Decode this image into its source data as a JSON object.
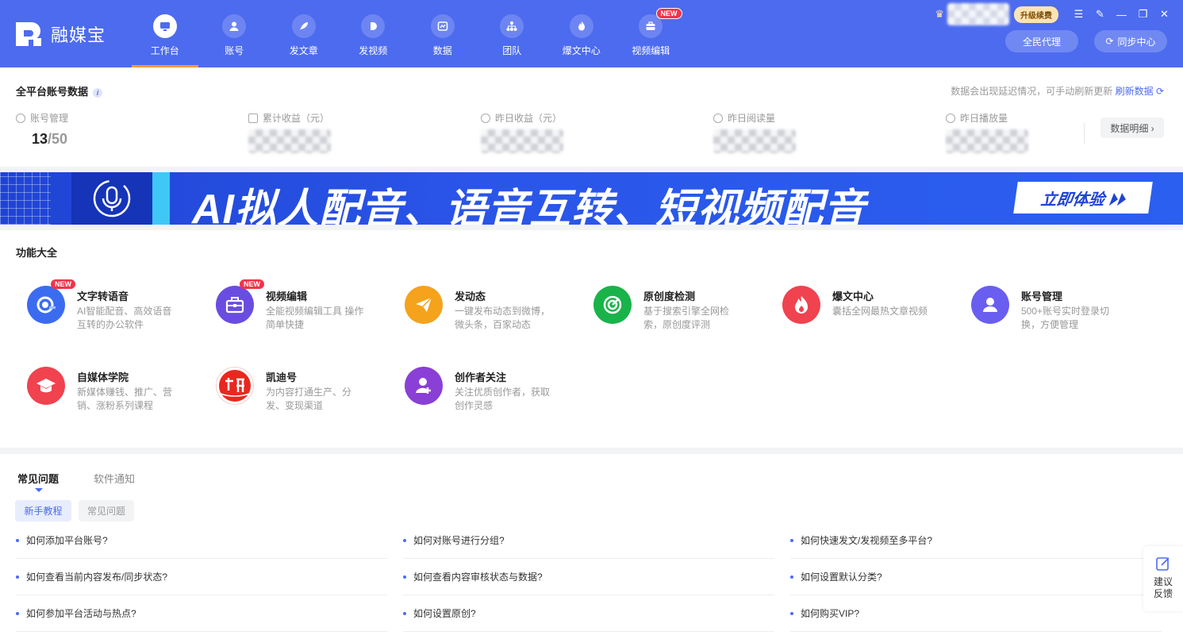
{
  "app": {
    "name": "融媒宝"
  },
  "nav": [
    {
      "label": "工作台",
      "icon": "monitor-icon",
      "active": true
    },
    {
      "label": "账号",
      "icon": "user-icon"
    },
    {
      "label": "发文章",
      "icon": "feather-icon"
    },
    {
      "label": "发视频",
      "icon": "play-icon"
    },
    {
      "label": "数据",
      "icon": "chart-icon"
    },
    {
      "label": "团队",
      "icon": "team-icon"
    },
    {
      "label": "爆文中心",
      "icon": "flame-icon"
    },
    {
      "label": "视频编辑",
      "icon": "toolbox-icon",
      "badge": "NEW"
    }
  ],
  "header": {
    "upgrade_label": "升级续费",
    "agent_label": "全民代理",
    "sync_label": "同步中心"
  },
  "account_data": {
    "title": "全平台账号数据",
    "refresh_note": "数据会出现延迟情况，可手动刷新更新",
    "refresh_link": "刷新数据",
    "stats": [
      {
        "label": "账号管理",
        "value": "13",
        "total": "/50"
      },
      {
        "label": "累计收益（元）"
      },
      {
        "label": "昨日收益（元）"
      },
      {
        "label": "昨日阅读量"
      },
      {
        "label": "昨日播放量"
      }
    ],
    "detail_button": "数据明细 ›"
  },
  "banner": {
    "text": "AI拟人配音、语音互转、短视频配音",
    "button": "立即体验 ⏵⏵"
  },
  "features": {
    "title": "功能大全",
    "items": [
      {
        "title": "文字转语音",
        "desc": "AI智能配音、高效语音互转的办公软件",
        "badge": "NEW",
        "color": "#3b6cf0",
        "icon": "voice-icon"
      },
      {
        "title": "视频编辑",
        "desc": "全能视频编辑工具 操作简单快捷",
        "badge": "NEW",
        "color": "#6a4de0",
        "icon": "toolbox-icon"
      },
      {
        "title": "发动态",
        "desc": "一键发布动态到微博，微头条，百家动态",
        "color": "#f5a21c",
        "icon": "paper-plane-icon"
      },
      {
        "title": "原创度检测",
        "desc": "基于搜索引擎全网检索，原创度评测",
        "color": "#19b34a",
        "icon": "radar-icon"
      },
      {
        "title": "爆文中心",
        "desc": "囊括全网最热文章视频",
        "color": "#f0424f",
        "icon": "flame-icon"
      },
      {
        "title": "账号管理",
        "desc": "500+账号实时登录切换，方便管理",
        "color": "#6a5ef0",
        "icon": "user-icon"
      },
      {
        "title": "自媒体学院",
        "desc": "新媒体赚钱、推广、营销、涨粉系列课程",
        "color": "#f0424f",
        "icon": "graduation-cap-icon"
      },
      {
        "title": "凯迪号",
        "desc": "为内容打通生产、分发、变现渠道",
        "color": "#e8281e",
        "icon": "kaidi-logo-icon"
      },
      {
        "title": "创作者关注",
        "desc": "关注优质创作者，获取创作灵感",
        "color": "#8a3fd6",
        "icon": "user-add-icon"
      }
    ]
  },
  "faq": {
    "tabs": [
      "常见问题",
      "软件通知"
    ],
    "chips": [
      "新手教程",
      "常见问题"
    ],
    "items": [
      "如何添加平台账号?",
      "如何对账号进行分组?",
      "如何快速发文/发视频至多平台?",
      "如何查看当前内容发布/同步状态?",
      "如何查看内容审核状态与数据?",
      "如何设置默认分类?",
      "如何参加平台活动与热点?",
      "如何设置原创?",
      "如何购买VIP?"
    ]
  },
  "feedback": {
    "label": "建议反馈"
  }
}
